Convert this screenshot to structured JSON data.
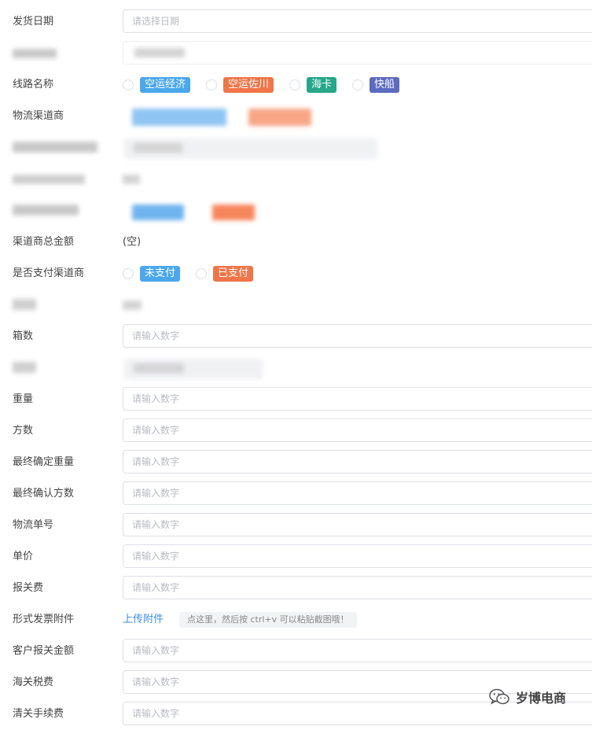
{
  "fields": {
    "ship_date": {
      "label": "发货日期",
      "placeholder": "请选择日期"
    },
    "route_name": {
      "label": "线路名称",
      "options": [
        "空运经济",
        "空运佐川",
        "海卡",
        "快船"
      ]
    },
    "logistics_provider": {
      "label": "物流渠道商"
    },
    "provider_total": {
      "label": "渠道商总金额",
      "value": "(空)"
    },
    "paid_provider": {
      "label": "是否支付渠道商",
      "options": [
        "未支付",
        "已支付"
      ]
    },
    "boxes": {
      "label": "箱数",
      "placeholder": "请输入数字"
    },
    "weight": {
      "label": "重量",
      "placeholder": "请输入数字"
    },
    "volume": {
      "label": "方数",
      "placeholder": "请输入数字"
    },
    "final_weight": {
      "label": "最终确定重量",
      "placeholder": "请输入数字"
    },
    "final_volume": {
      "label": "最终确认方数",
      "placeholder": "请输入数字"
    },
    "tracking_no": {
      "label": "物流单号",
      "placeholder": "请输入数字"
    },
    "unit_price": {
      "label": "单价",
      "placeholder": "请输入数字"
    },
    "customs_fee": {
      "label": "报关费",
      "placeholder": "请输入数字"
    },
    "invoice_attachment": {
      "label": "形式发票附件",
      "upload_label": "上传附件",
      "hint": "点这里，然后按 ctrl+v 可以粘贴截图哦！"
    },
    "customer_declared_amount": {
      "label": "客户报关金额",
      "placeholder": "请输入数字"
    },
    "customs_tax": {
      "label": "海关税费",
      "placeholder": "请输入数字"
    },
    "clearance_fee": {
      "label": "清关手续费",
      "placeholder": "请输入数字"
    }
  },
  "watermark": {
    "text": "岁博电商",
    "icon": "wechat-icon"
  },
  "colors": {
    "tag_blue": "#4aa7ec",
    "tag_orange": "#f07548",
    "tag_teal": "#26a68a",
    "tag_indigo": "#5b6bbf",
    "link_blue": "#3a8ee6",
    "border": "#dcdfe6"
  }
}
